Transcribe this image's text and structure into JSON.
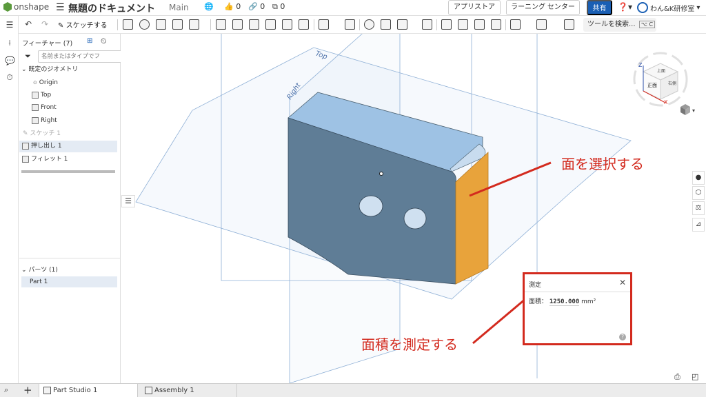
{
  "app": {
    "logo": "onshape",
    "doc_title": "無題のドキュメント",
    "branch": "Main",
    "likes": "0",
    "links": "0",
    "copies": "0",
    "app_store": "アプリストア",
    "learning_center": "ラーニング センター",
    "share": "共有",
    "user": "わん&K研修室"
  },
  "toolbar": {
    "sketch": "スケッチする",
    "search": "ツールを検索...",
    "search_shortcut": "⌥ C"
  },
  "features": {
    "header": "フィーチャー (7)",
    "search_placeholder": "名前またはタイプでフ",
    "default_geometry": "既定のジオメトリ",
    "origin": "Origin",
    "top": "Top",
    "front": "Front",
    "right": "Right",
    "sketch1": "スケッチ 1",
    "extrude1": "押し出し 1",
    "fillet1": "フィレット 1"
  },
  "parts": {
    "header": "パーツ (1)",
    "part1": "Part 1"
  },
  "viewport": {
    "plane_top": "Top",
    "plane_right": "Right",
    "cube_top": "上面",
    "cube_front": "正面",
    "cube_right": "右側",
    "axis_z": "Z",
    "axis_x": "X"
  },
  "measure": {
    "title": "測定",
    "area_label": "面積：",
    "area_value": "1250.000",
    "area_unit": "mm²"
  },
  "annotations": {
    "select_face": "面を選択する",
    "measure_area": "面積を測定する"
  },
  "tabs": {
    "add": "+",
    "part_studio": "Part Studio 1",
    "assembly": "Assembly 1"
  },
  "colors": {
    "accent": "#1a5fb4",
    "annotation_red": "#d32a1e",
    "face_highlight": "#e8a33b",
    "part_body": "#6a8aa6"
  }
}
